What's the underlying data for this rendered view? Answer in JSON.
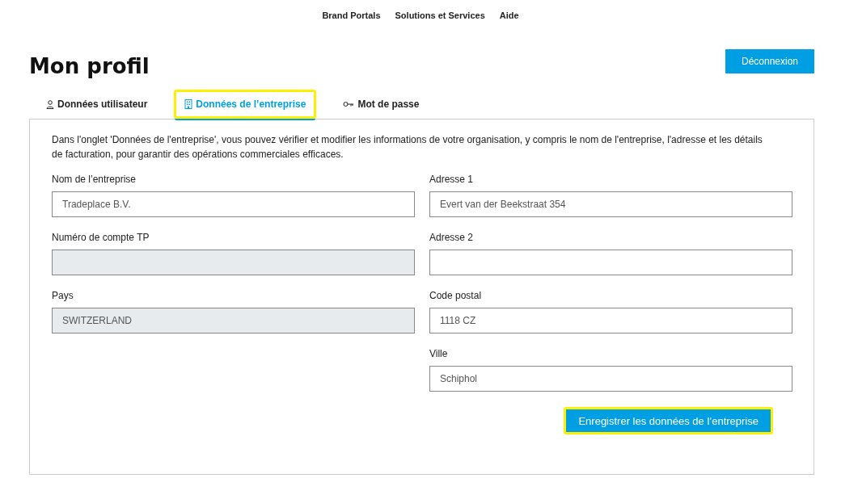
{
  "top_nav": [
    {
      "label": "Brand Portals"
    },
    {
      "label": "Solutions et Services"
    },
    {
      "label": "Aide"
    }
  ],
  "page_title": "Mon profil",
  "logout_button": "Déconnexion",
  "tabs": [
    {
      "label": "Données utilisateur",
      "selected": false,
      "highlighted": false
    },
    {
      "label": "Données de l’entreprise",
      "selected": true,
      "highlighted": true
    },
    {
      "label": "Mot de passe",
      "selected": false,
      "highlighted": false
    }
  ],
  "intro": "Dans l'onglet 'Données de l'entreprise', vous pouvez vérifier et modifier les informations de votre organisation, y compris le nom de l'entreprise, l'adresse et les détails de facturation, pour garantir des opérations commerciales efficaces.",
  "form": {
    "columns": [
      [
        {
          "label": "Nom de l’entreprise",
          "value": "Tradeplace B.V.",
          "disabled": false
        },
        {
          "label": "Numéro de compte TP",
          "disabled": true
        },
        {
          "label": "Pays",
          "value": "SWITZERLAND",
          "disabled": true
        }
      ],
      [
        {
          "label": "Adresse 1",
          "value": "Evert van der Beekstraat 354",
          "disabled": false
        },
        {
          "label": "Adresse 2",
          "disabled": false
        },
        {
          "label": "Code postal",
          "value": "1118 CZ",
          "disabled": false
        },
        {
          "label": "Ville",
          "value": "Schiphol",
          "disabled": false
        }
      ]
    ],
    "save_button": {
      "label": "Enregistrer les données de l’entreprise",
      "highlighted": true
    }
  }
}
